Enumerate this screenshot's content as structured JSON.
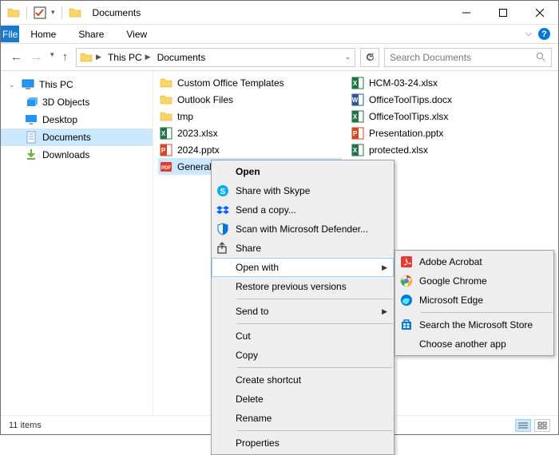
{
  "title": "Documents",
  "ribbon": {
    "file": "File",
    "home": "Home",
    "share": "Share",
    "view": "View"
  },
  "breadcrumb": {
    "thispc": "This PC",
    "docs": "Documents"
  },
  "search": {
    "placeholder": "Search Documents"
  },
  "tree": {
    "thispc": "This PC",
    "objects3d": "3D Objects",
    "desktop": "Desktop",
    "documents": "Documents",
    "downloads": "Downloads"
  },
  "files": {
    "c0": "Custom Office Templates",
    "c1": "Outlook Files",
    "c2": "tmp",
    "c3": "2023.xlsx",
    "c4": "2024.pptx",
    "c5": "General",
    "d0": "HCM-03-24.xlsx",
    "d1": "OfficeToolTips.docx",
    "d2": "OfficeToolTips.xlsx",
    "d3": "Presentation.pptx",
    "d4": "protected.xlsx"
  },
  "status": {
    "items": "11 items"
  },
  "ctx": {
    "open": "Open",
    "skype": "Share with Skype",
    "sendcopy": "Send a copy...",
    "defender": "Scan with Microsoft Defender...",
    "share": "Share",
    "openwith": "Open with",
    "restore": "Restore previous versions",
    "sendto": "Send to",
    "cut": "Cut",
    "copy": "Copy",
    "shortcut": "Create shortcut",
    "delete": "Delete",
    "rename": "Rename",
    "props": "Properties"
  },
  "openwith": {
    "acrobat": "Adobe Acrobat",
    "chrome": "Google Chrome",
    "edge": "Microsoft Edge",
    "store": "Search the Microsoft Store",
    "another": "Choose another app"
  }
}
